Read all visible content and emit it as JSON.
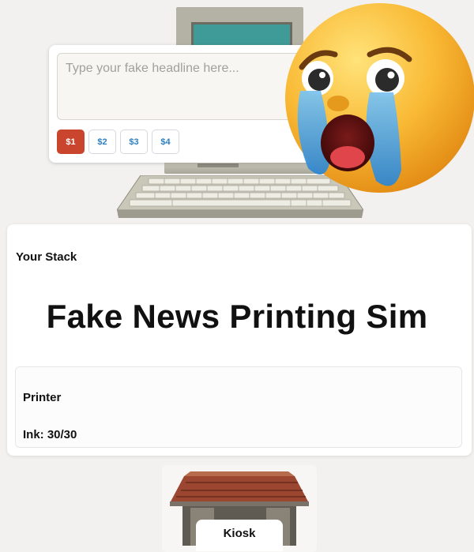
{
  "editor": {
    "headline_placeholder": "Type your fake headline here...",
    "headline_value": "",
    "prices": [
      "$1",
      "$2",
      "$3",
      "$4"
    ],
    "selected_price": "$1"
  },
  "stack": {
    "title": "Your Stack",
    "game_title": "Fake News Printing Sim",
    "printer": {
      "label": "Printer",
      "ink": "Ink: 30/30"
    }
  },
  "shop": {
    "kiosk_label": "Kiosk"
  },
  "colors": {
    "accent": "#c9452e",
    "link_blue": "#2b7fc2",
    "background": "#f3f1ef"
  },
  "icons": {
    "emoji": "crying-face-emoji",
    "computer": "retro-computer-illustration",
    "kiosk": "kiosk-building-illustration"
  }
}
